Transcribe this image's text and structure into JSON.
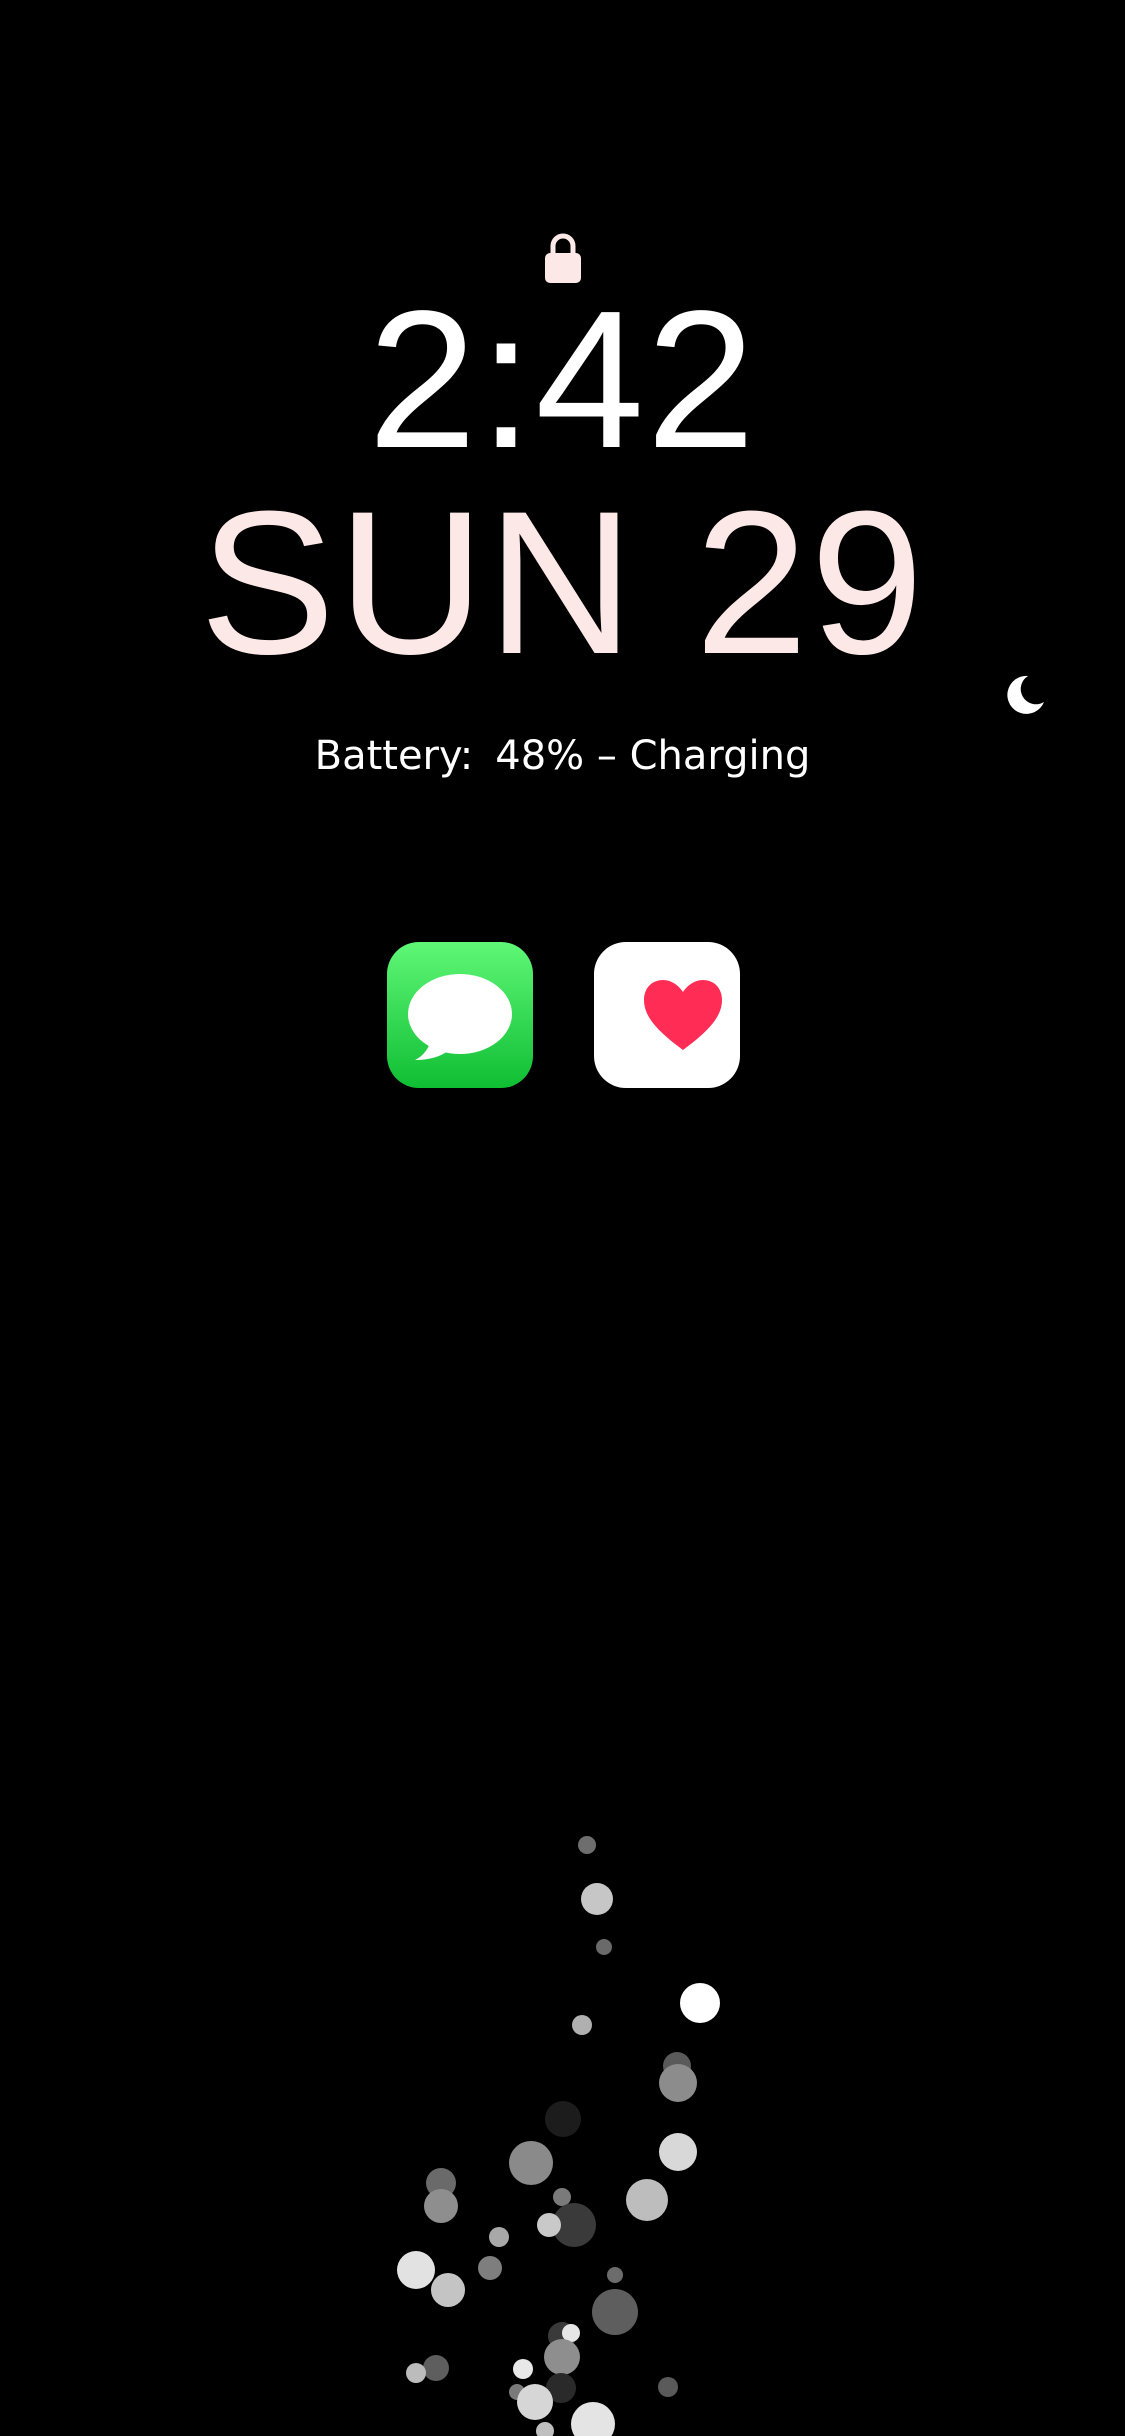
{
  "lockscreen": {
    "time": "2:42",
    "date": "SUN 29",
    "battery_label": "Battery:",
    "battery_value": "48% – Charging",
    "colors": {
      "background": "#000000",
      "time_text": "#ffffff",
      "date_text": "#fde8e8",
      "lock_icon": "#fde8e8",
      "messages_gradient_top": "#5ff777",
      "messages_gradient_bottom": "#0fbe33",
      "health_heart": "#ff2d55"
    },
    "icons": {
      "lock": "lock-icon",
      "focus": "moon-icon"
    }
  },
  "apps": [
    {
      "name": "Messages",
      "icon": "messages-icon"
    },
    {
      "name": "Health",
      "icon": "health-icon"
    }
  ],
  "wallpaper": {
    "style": "bubbles"
  }
}
